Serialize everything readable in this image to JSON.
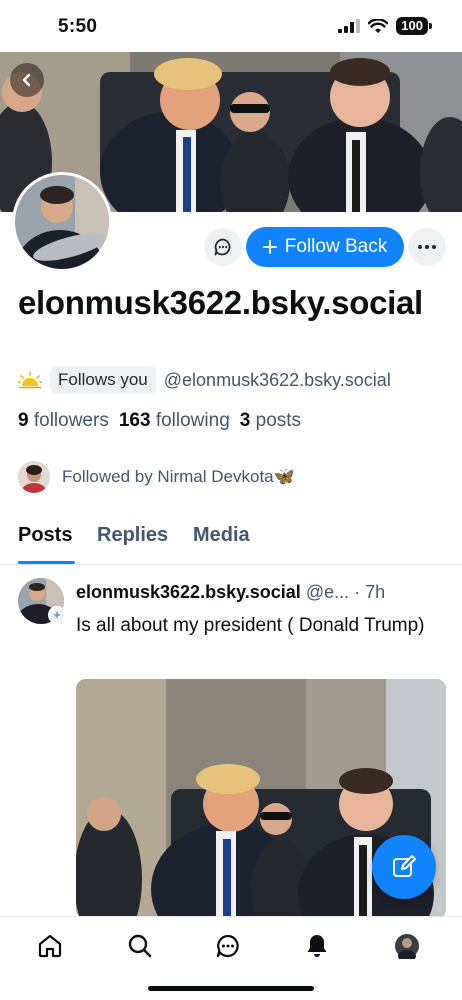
{
  "status_bar": {
    "time": "5:50",
    "battery": "100"
  },
  "profile": {
    "display_name": "elonmusk3622.bsky.social",
    "follows_you_badge": "Follows you",
    "handle": "@elonmusk3622.bsky.social",
    "stats": {
      "followers_count": "9",
      "followers_label": "followers",
      "following_count": "163",
      "following_label": "following",
      "posts_count": "3",
      "posts_label": "posts"
    },
    "followed_by_text": "Followed by Nirmal Devkota🦋"
  },
  "actions": {
    "follow_back_label": "Follow Back"
  },
  "tabs": [
    "Posts",
    "Replies",
    "Media"
  ],
  "post": {
    "author": "elonmusk3622.bsky.social",
    "handle_truncated": "@e...",
    "time": "· 7h",
    "text": "Is all about my president ( Donald Trump)"
  },
  "icons": {
    "back": "chevron-left-icon",
    "message": "chat-bubble-icon",
    "more": "ellipsis-icon",
    "sun": "sun-icon",
    "compose": "pencil-icon",
    "nav": [
      "home-icon",
      "search-icon",
      "chat-icon",
      "bell-icon",
      "avatar"
    ]
  },
  "colors": {
    "accent": "#1083fe",
    "muted_text": "#42576c",
    "badge_bg": "#eef1f4"
  }
}
